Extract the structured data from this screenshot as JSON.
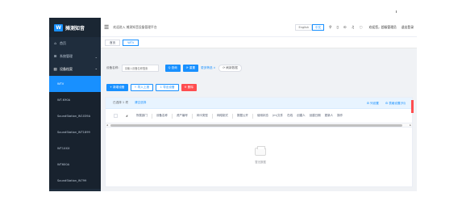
{
  "app": {
    "logo_mark": "W",
    "logo_text": "摊测知音"
  },
  "sidebar": {
    "menu": [
      {
        "icon": "⌂",
        "label": "首页",
        "open": false
      },
      {
        "icon": "⊞",
        "label": "系统管理",
        "open": false
      },
      {
        "icon": "▤",
        "label": "设备档案",
        "open": true
      }
    ],
    "sub_items": [
      {
        "label": "WTV",
        "active": true
      },
      {
        "label": "WT-K90A",
        "active": false
      },
      {
        "label": "SoundStation_W1039A",
        "active": false
      },
      {
        "label": "SoundStation_WT1899",
        "active": false
      },
      {
        "label": "WT1XXX",
        "active": false
      },
      {
        "label": "WT600A",
        "active": false
      },
      {
        "label": "SoundStation_W799",
        "active": false
      }
    ]
  },
  "header": {
    "hamburger_icon": "hamburger-icon",
    "title": "欢迎进入 摊测知音设备管理平台",
    "lang_en": "English",
    "lang_zh": "中文",
    "user": "欢迎您，超级管理员",
    "logout": "退出登录"
  },
  "tabs": [
    {
      "label": "首页",
      "active": false
    },
    {
      "label": "WTV",
      "active": true
    }
  ],
  "search": {
    "label": "设备名称:",
    "placeholder": "请输入设备名称搜索",
    "search_btn": "Q 查询",
    "reset_btn": "⟳ 重置",
    "more_link": "更多筛选 ∨",
    "refresh_btn": "⟳ 刷新数据"
  },
  "actions": {
    "add_btn": "+ 新增设备",
    "import_btn": "⇪ 导入上报",
    "export_btn": "⇩ 导出设备",
    "delete_btn": "⊖ 删除"
  },
  "table": {
    "selected_info": "已选择 1 项",
    "clear_link": "清空选择",
    "setting_link": "⚙ 列设置",
    "settings_link2": "⚙ 表格设置(列)",
    "headers": [
      "所属部门",
      "设备名称",
      "资产编号",
      "网卡类型",
      "网络制式",
      "数据公开",
      "使用状态",
      "(m)文件",
      "在线",
      "创建人",
      "创建日期",
      "更新人",
      "操作"
    ],
    "empty_text": "暂无数据"
  },
  "colors": {
    "primary": "#1890ff",
    "danger": "#ff4d4f",
    "sidebar_bg": "#1f2d3d"
  }
}
